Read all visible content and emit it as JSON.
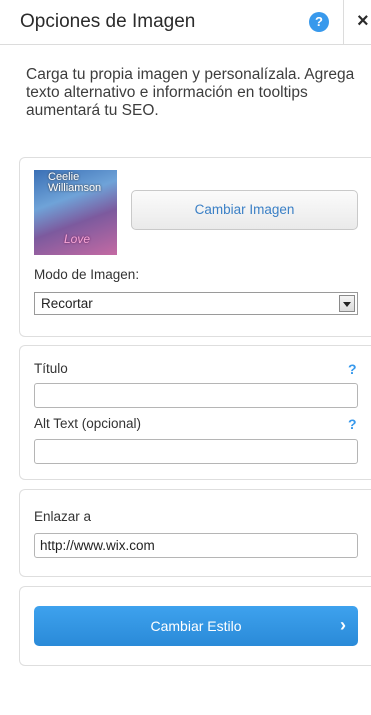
{
  "header": {
    "title": "Opciones de Imagen",
    "help_icon": "?",
    "close_icon": "×"
  },
  "intro": "Carga tu propia imagen y personalízala. Agrega texto alternativo e información en tooltips aumentará tu SEO.",
  "image_card": {
    "thumbnail_text_top": "Ceelie Williamson",
    "thumbnail_text_bottom": "Love",
    "change_image_label": "Cambiar Imagen",
    "mode_label": "Modo de Imagen:",
    "mode_value": "Recortar"
  },
  "meta_card": {
    "title_label": "Título",
    "title_help": "?",
    "title_value": "",
    "alt_label": "Alt Text (opcional)",
    "alt_help": "?",
    "alt_value": ""
  },
  "link_card": {
    "label": "Enlazar a",
    "value": "http://www.wix.com"
  },
  "style_card": {
    "button_label": "Cambiar Estilo",
    "arrow": "›"
  },
  "colors": {
    "accent": "#3899ec",
    "button_blue": "#2a8ad8",
    "link_text": "#3b80c6"
  }
}
